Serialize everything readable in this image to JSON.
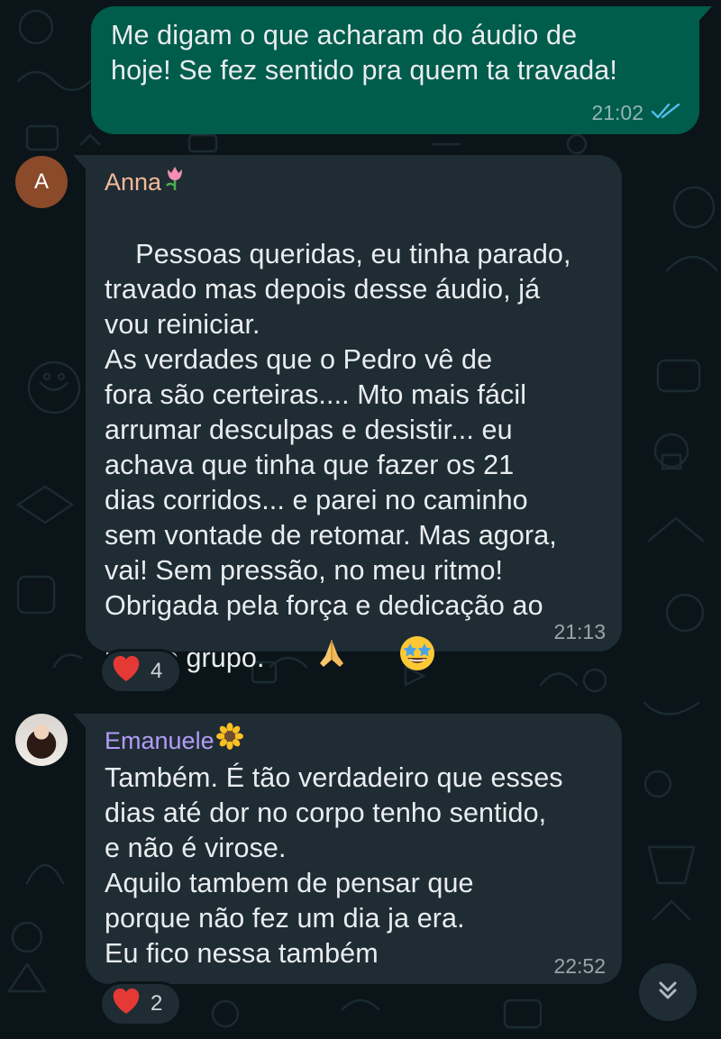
{
  "messages": [
    {
      "direction": "outgoing",
      "text": "Me digam o que acharam do áudio de\nhoje! Se fez sentido pra quem ta travada!",
      "time": "21:02",
      "status_icon": "double-check-icon"
    },
    {
      "direction": "incoming",
      "sender": "Anna",
      "sender_emoji": "tulip-icon",
      "sender_color": "#f5b99a",
      "avatar_initial": "A",
      "text": "Pessoas queridas, eu tinha parado,\ntravado mas depois desse áudio, já\nvou reiniciar.\nAs verdades que o Pedro vê de\nfora são certeiras.... Mto mais fácil\narrumar desculpas e desistir... eu\nachava que tinha que fazer os 21\ndias corridos... e parei no caminho\nsem vontade de retomar. Mas agora,\nvai! Sem pressão, no meu ritmo!\nObrigada pela força e dedicação ao",
      "last_line": "nosso grupo.",
      "trailing_emojis": [
        "folded-hands-icon",
        "star-struck-icon"
      ],
      "time": "21:13",
      "reaction": {
        "emoji": "heart-icon",
        "count": "4"
      }
    },
    {
      "direction": "incoming",
      "sender": "Emanuele",
      "sender_emoji": "sunflower-icon",
      "sender_color": "#b39cf7",
      "text": "Também. É tão verdadeiro que esses\ndias até dor no corpo tenho sentido,\ne não é virose.\nAquilo tambem de pensar que\nporque não fez um dia ja era.\nEu fico nessa também",
      "time": "22:52",
      "reaction": {
        "emoji": "heart-icon",
        "count": "2"
      }
    }
  ],
  "scroll_button_icon": "double-chevron-down-icon",
  "colors": {
    "outgoing_bubble": "#005c4b",
    "incoming_bubble": "#1f2c34",
    "background": "#0b1418",
    "read_ticks": "#53bdeb"
  }
}
